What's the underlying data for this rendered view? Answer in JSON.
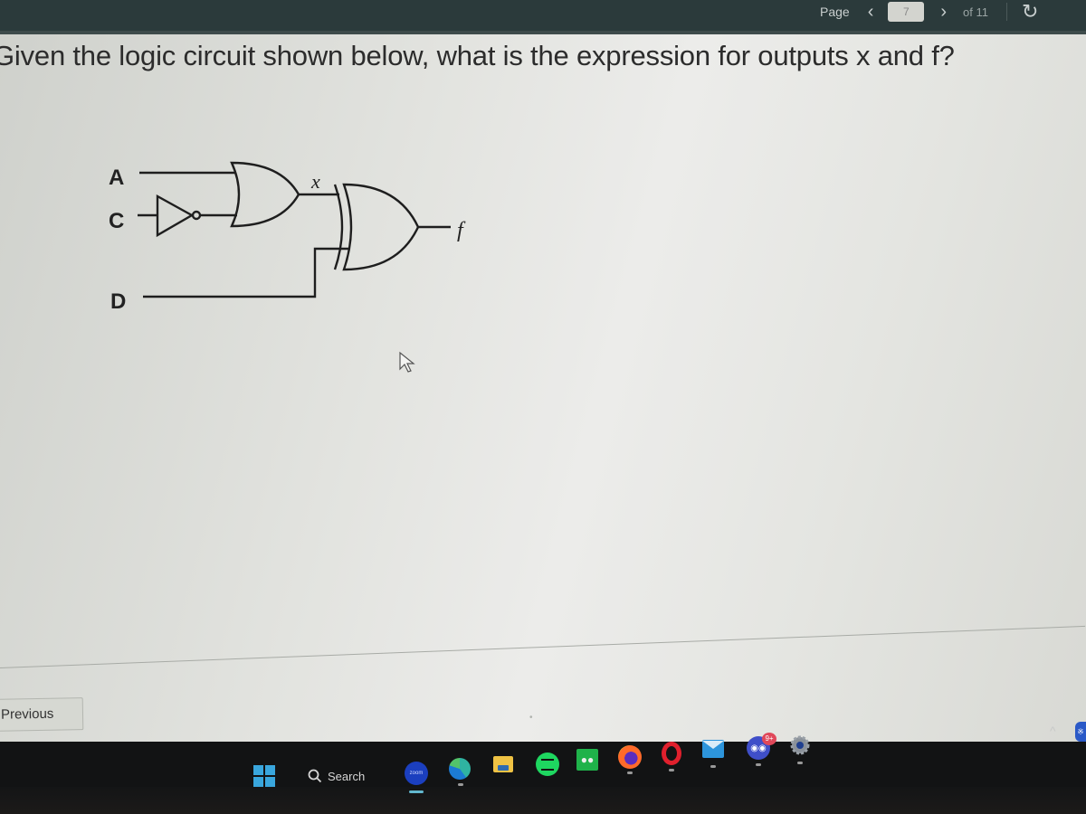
{
  "toolbar": {
    "page_label": "Page",
    "prev_icon": "chevron-left-icon",
    "current_page": "7",
    "next_icon": "chevron-right-icon",
    "total_pages": "of 11",
    "refresh_icon": "refresh-icon"
  },
  "question": {
    "text": "Given the logic circuit shown below, what is the expression for outputs x and f?"
  },
  "circuit": {
    "inputs": [
      "A",
      "C",
      "D"
    ],
    "gates": [
      {
        "type": "NOT",
        "input": "C"
      },
      {
        "type": "OR",
        "inputs": [
          "A",
          "NOT C"
        ],
        "output": "x"
      },
      {
        "type": "XOR",
        "inputs": [
          "x",
          "D"
        ],
        "output": "f"
      }
    ],
    "labels": {
      "x": "x",
      "f": "f",
      "A": "A",
      "C": "C",
      "D": "D"
    }
  },
  "navigation": {
    "previous_label": "Previous"
  },
  "taskbar": {
    "start_icon": "windows-start-icon",
    "search_label": "Search",
    "apps": [
      {
        "name": "Zoom",
        "icon": "zoom-icon",
        "label": "zoom"
      },
      {
        "name": "Microsoft Edge",
        "icon": "edge-icon"
      },
      {
        "name": "File Explorer",
        "icon": "folder-icon"
      },
      {
        "name": "Spotify",
        "icon": "spotify-icon"
      },
      {
        "name": "WeChat",
        "icon": "wechat-icon"
      },
      {
        "name": "Firefox",
        "icon": "firefox-icon"
      },
      {
        "name": "Opera",
        "icon": "opera-icon"
      },
      {
        "name": "Mail",
        "icon": "mail-icon"
      },
      {
        "name": "Discord",
        "icon": "discord-icon",
        "badge": "9+"
      },
      {
        "name": "Settings",
        "icon": "settings-icon"
      }
    ],
    "tray": {
      "chevron_icon": "chevron-up-icon",
      "bluetooth_icon": "bluetooth-icon"
    }
  },
  "colors": {
    "topbar": "#2b3a3b",
    "content_bg": "#e2e3df",
    "taskbar": "#121314",
    "windows_blue": "#39a6dd"
  }
}
